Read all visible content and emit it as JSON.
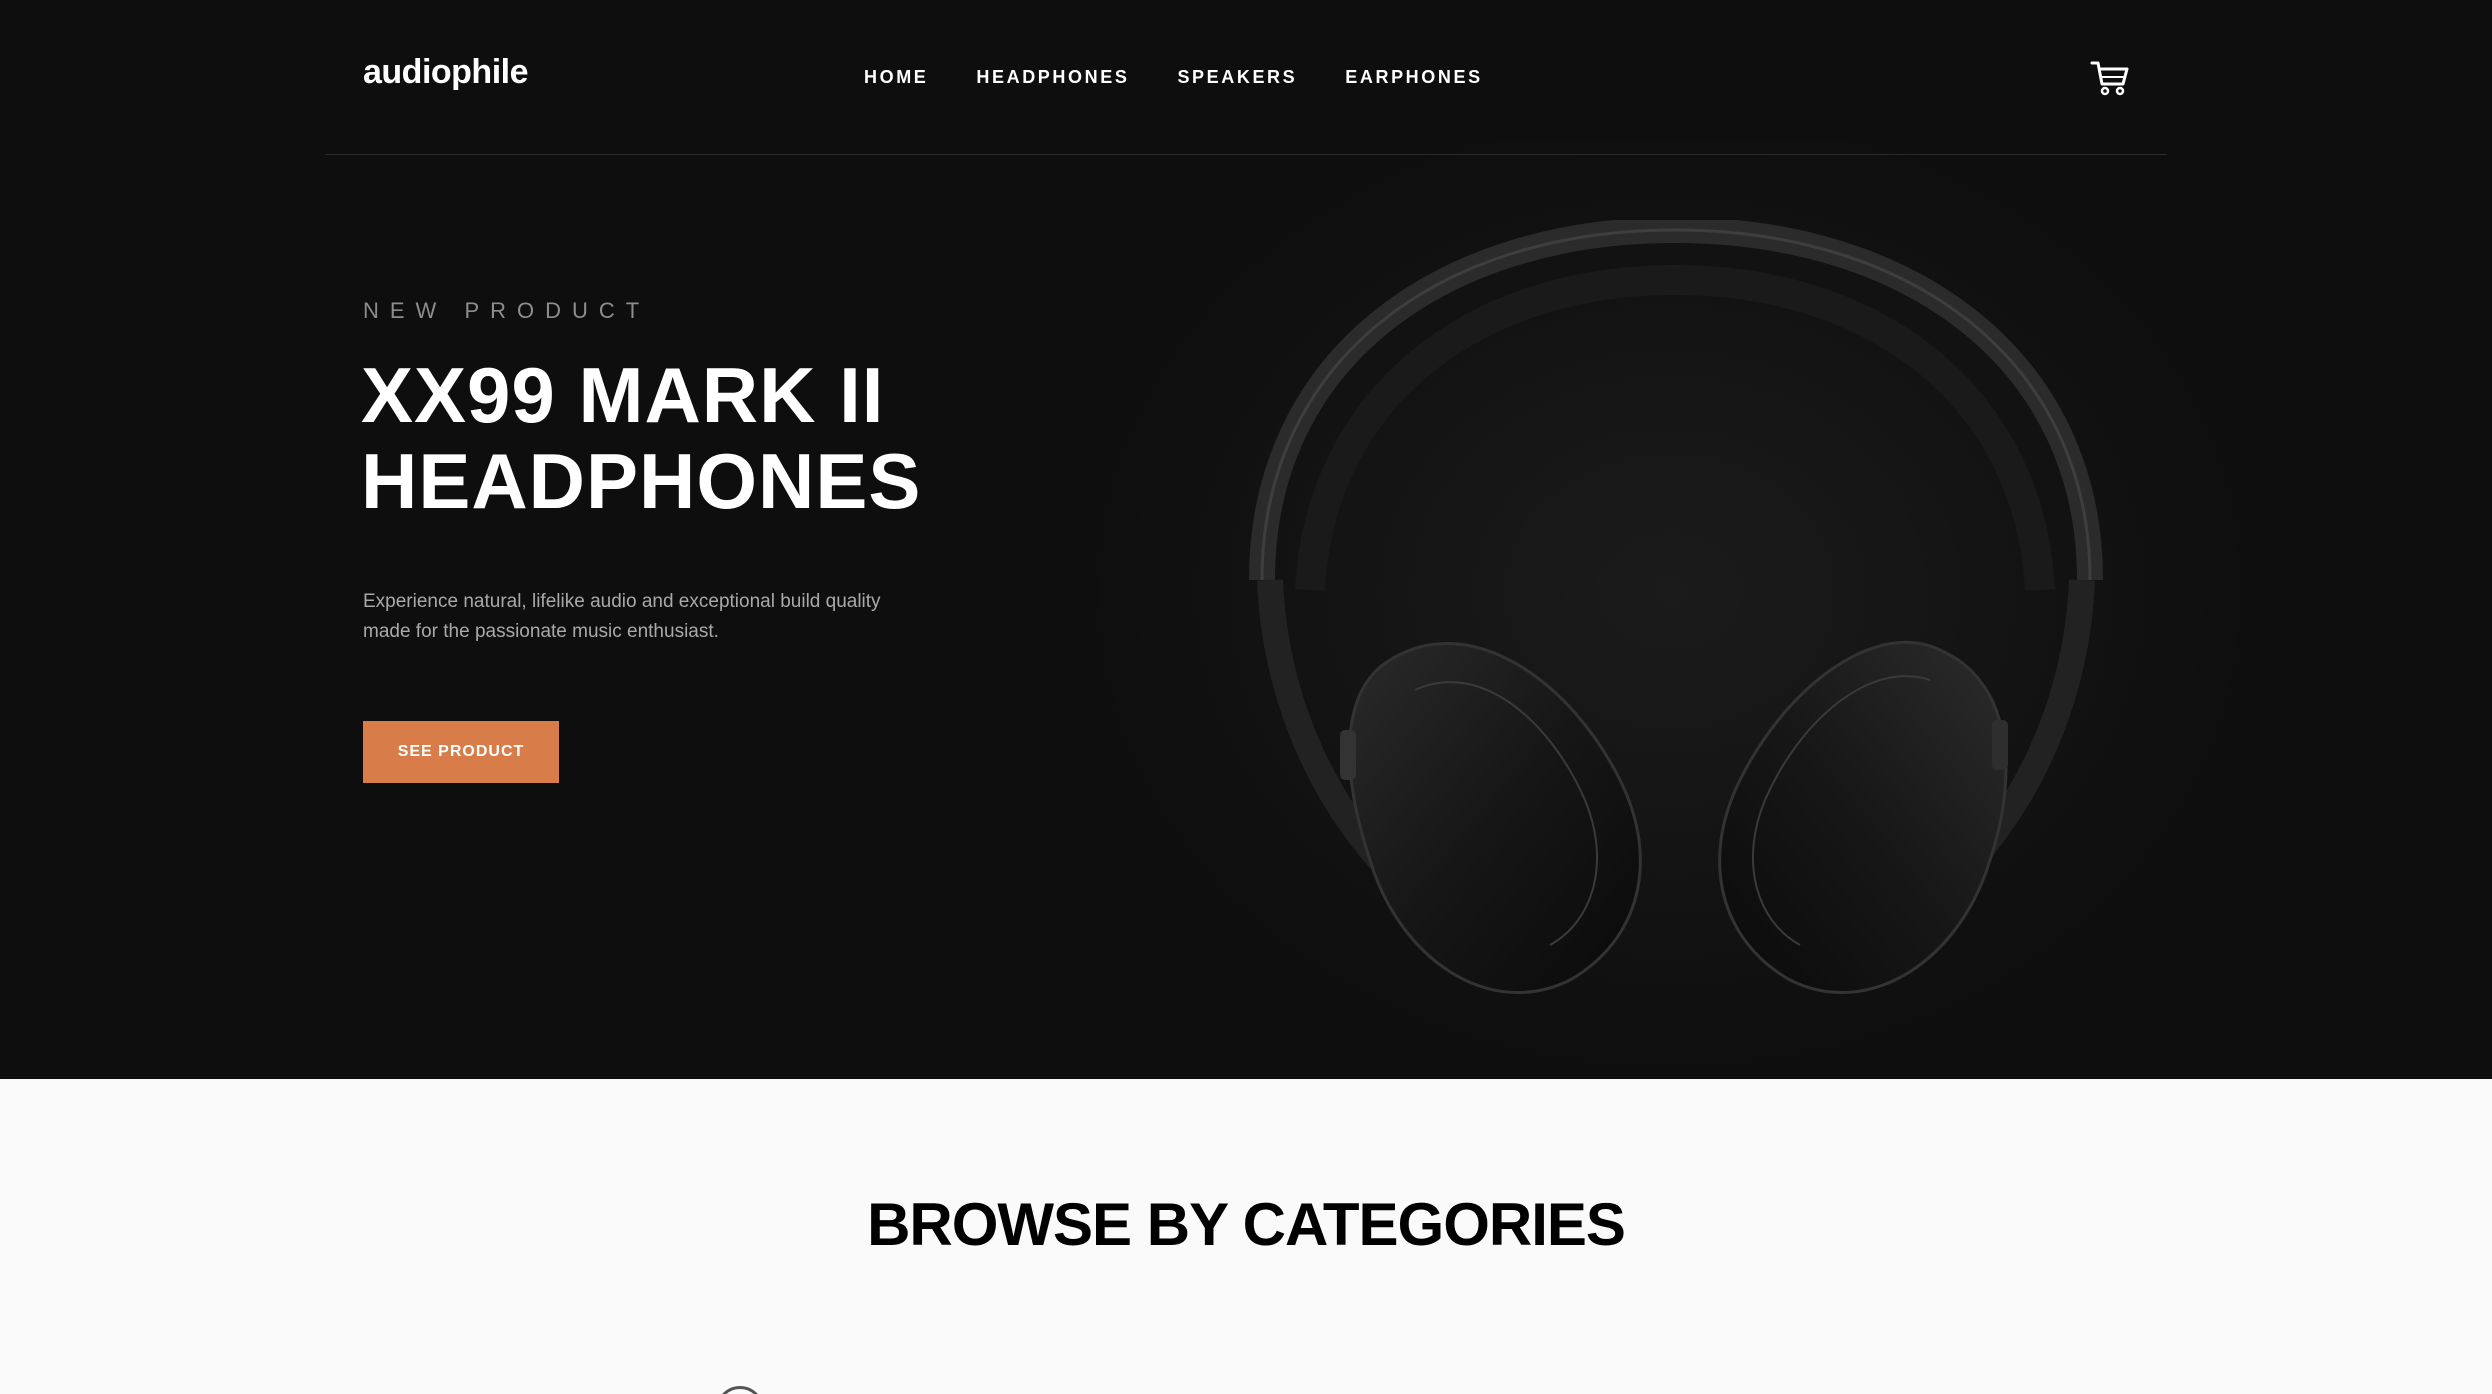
{
  "brand": {
    "logo_text": "audiophile",
    "accent_color": "#d87d4a"
  },
  "nav": {
    "links": [
      "HOME",
      "HEADPHONES",
      "SPEAKERS",
      "EARPHONES"
    ],
    "cart_icon": "cart-icon"
  },
  "hero": {
    "overline": "NEW PRODUCT",
    "title_line1": "XX99 MARK II",
    "title_line2": "HEADPHONES",
    "description": "Experience natural, lifelike audio and exceptional build quality made for the passionate music enthusiast.",
    "cta_label": "SEE PRODUCT",
    "image": "headphones-image"
  },
  "categories": {
    "heading": "BROWSE BY CATEGORIES"
  }
}
